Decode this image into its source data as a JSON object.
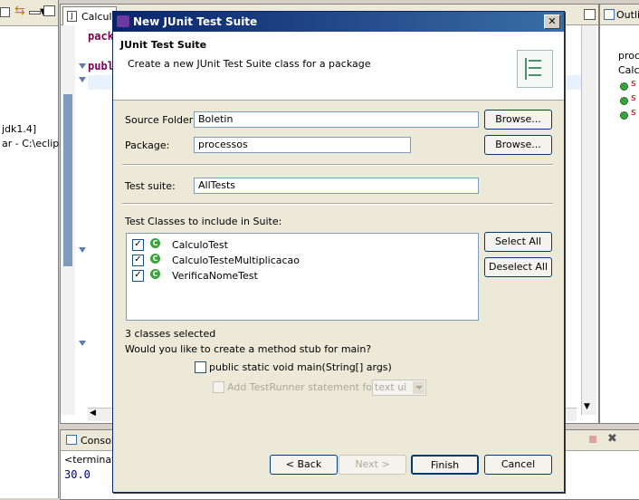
{
  "background": {
    "left_pane": {
      "line1": "jdk1.4]",
      "line2": "ar - C:\\eclipse"
    },
    "editor": {
      "tab_label": "Calculo",
      "code_line1": "pack",
      "code_line2": "publ"
    },
    "outline": {
      "tab_label": "Outli",
      "item1": "proc",
      "item2": "Calcu",
      "member": "s"
    },
    "console": {
      "tab_label": "Console",
      "status": "<terminate",
      "output": "30.0"
    }
  },
  "dialog": {
    "title": "New JUnit Test Suite",
    "header_title": "JUnit Test Suite",
    "header_desc": "Create a new JUnit Test Suite class for a package",
    "source_folder_label": "Source Folder:",
    "source_folder_value": "Boletin",
    "package_label": "Package:",
    "package_value": "processos",
    "browse_label": "Browse...",
    "test_suite_label": "Test suite:",
    "test_suite_value": "AllTests",
    "classes_label": "Test Classes to include in Suite:",
    "classes": [
      {
        "name": "CalculoTest",
        "checked": true
      },
      {
        "name": "CalculoTesteMultiplicacao",
        "checked": true
      },
      {
        "name": "VerificaNomeTest",
        "checked": true
      }
    ],
    "select_all": "Select All",
    "deselect_all": "Deselect All",
    "selected_count": "3 classes selected",
    "main_question": "Would you like to create a method stub for main?",
    "main_stub_label": "public static void main(String[] args)",
    "testrunner_label": "Add TestRunner statement for:",
    "testrunner_option": "text ui",
    "buttons": {
      "back": "< Back",
      "next": "Next >",
      "finish": "Finish",
      "cancel": "Cancel"
    }
  }
}
